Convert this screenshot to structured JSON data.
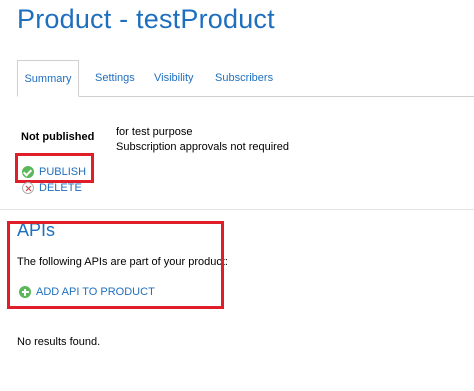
{
  "page": {
    "title": "Product - testProduct"
  },
  "tabs": [
    {
      "label": "Summary",
      "active": true
    },
    {
      "label": "Settings",
      "active": false
    },
    {
      "label": "Visibility",
      "active": false
    },
    {
      "label": "Subscribers",
      "active": false
    }
  ],
  "summary": {
    "status": "Not published",
    "description_line1": "for test purpose",
    "description_line2": "Subscription approvals not required",
    "publish_label": "PUBLISH",
    "delete_label": "DELETE"
  },
  "apis": {
    "heading": "APIs",
    "intro": "The following APIs are part of your product:",
    "add_label": "ADD API TO PRODUCT",
    "empty_text": "No results found."
  },
  "icons": {
    "publish": "check-circle-icon",
    "delete": "x-circle-icon",
    "add": "plus-circle-icon"
  },
  "colors": {
    "accent": "#1f6fbf",
    "highlight": "#e01e2a",
    "success": "#5ab85a"
  }
}
